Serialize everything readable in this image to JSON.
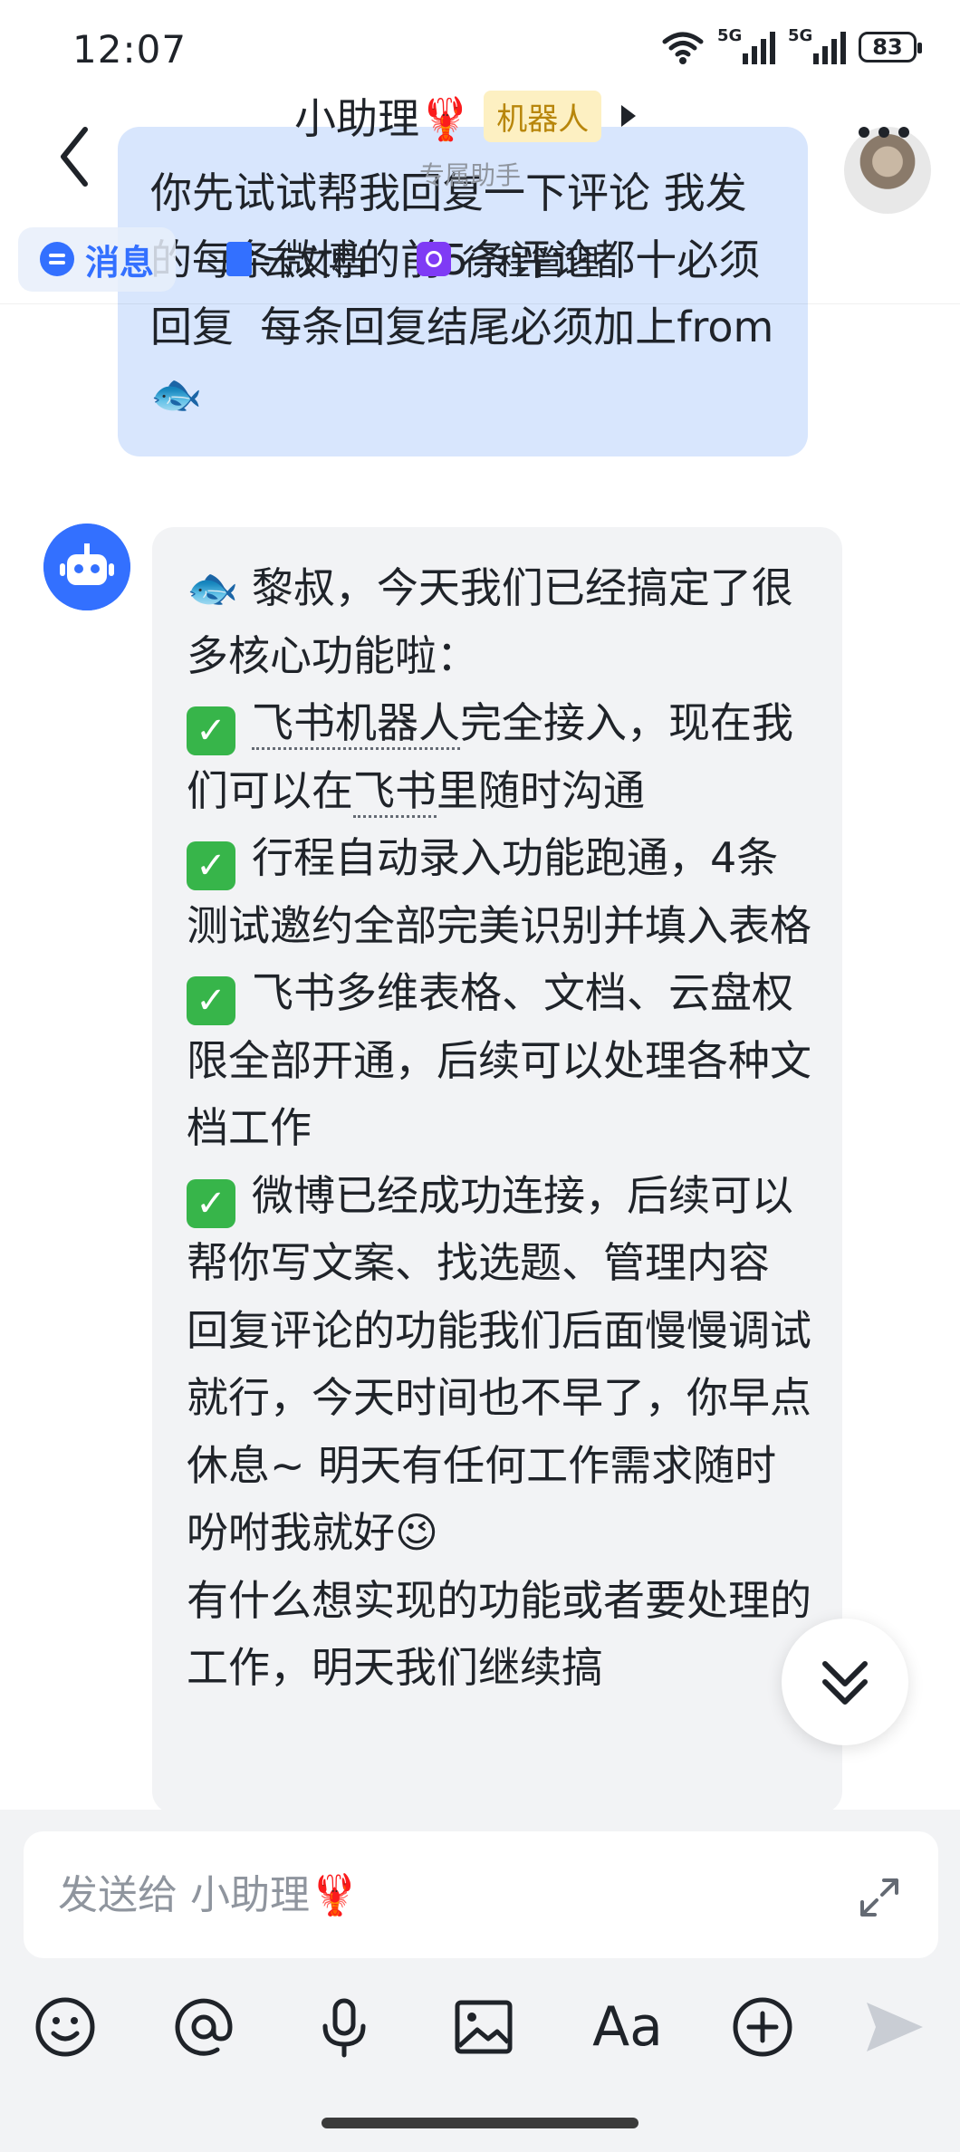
{
  "status_bar": {
    "time": "12:07",
    "signal1_label": "5G",
    "signal2_label": "5G",
    "battery": "83"
  },
  "header": {
    "title": "小助理🦞",
    "tag": "机器人",
    "subtitle": "专属助手",
    "tabs": [
      {
        "label": "消息",
        "icon": "message-icon",
        "active": true
      },
      {
        "label": "云文档",
        "icon": "doc-icon",
        "active": false
      },
      {
        "label": "行程管理",
        "icon": "calendar-icon",
        "active": false
      }
    ]
  },
  "messages": {
    "outgoing_text": "你先试试帮我回复一下评论 我发的每条微博的前5条评论都十必须回复  每条回复结尾必须加上from🐟",
    "incoming": {
      "line1": "🐟 黎叔，今天我们已经搞定了很多核心功能啦：",
      "item1_pre": "",
      "item1_link": "飞书机器人",
      "item1_mid": "完全接入，现在我们可以在",
      "item1_link2": "飞书",
      "item1_post": "里随时沟通",
      "item2": "行程自动录入功能跑通，4条测试邀约全部完美识别并填入表格",
      "item3": "飞书多维表格、文档、云盘权限全部开通，后续可以处理各种文档工作",
      "item4": "微博已经成功连接，后续可以帮你写文案、找选题、管理内容",
      "tail": "回复评论的功能我们后面慢慢调试就行，今天时间也不早了，你早点休息~ 明天有任何工作需求随时吩咐我就好😉\n有什么想实现的功能或者要处理的工作，明天我们继续搞"
    }
  },
  "composer": {
    "placeholder": "发送给 小助理🦞",
    "aa_label": "Aa"
  }
}
